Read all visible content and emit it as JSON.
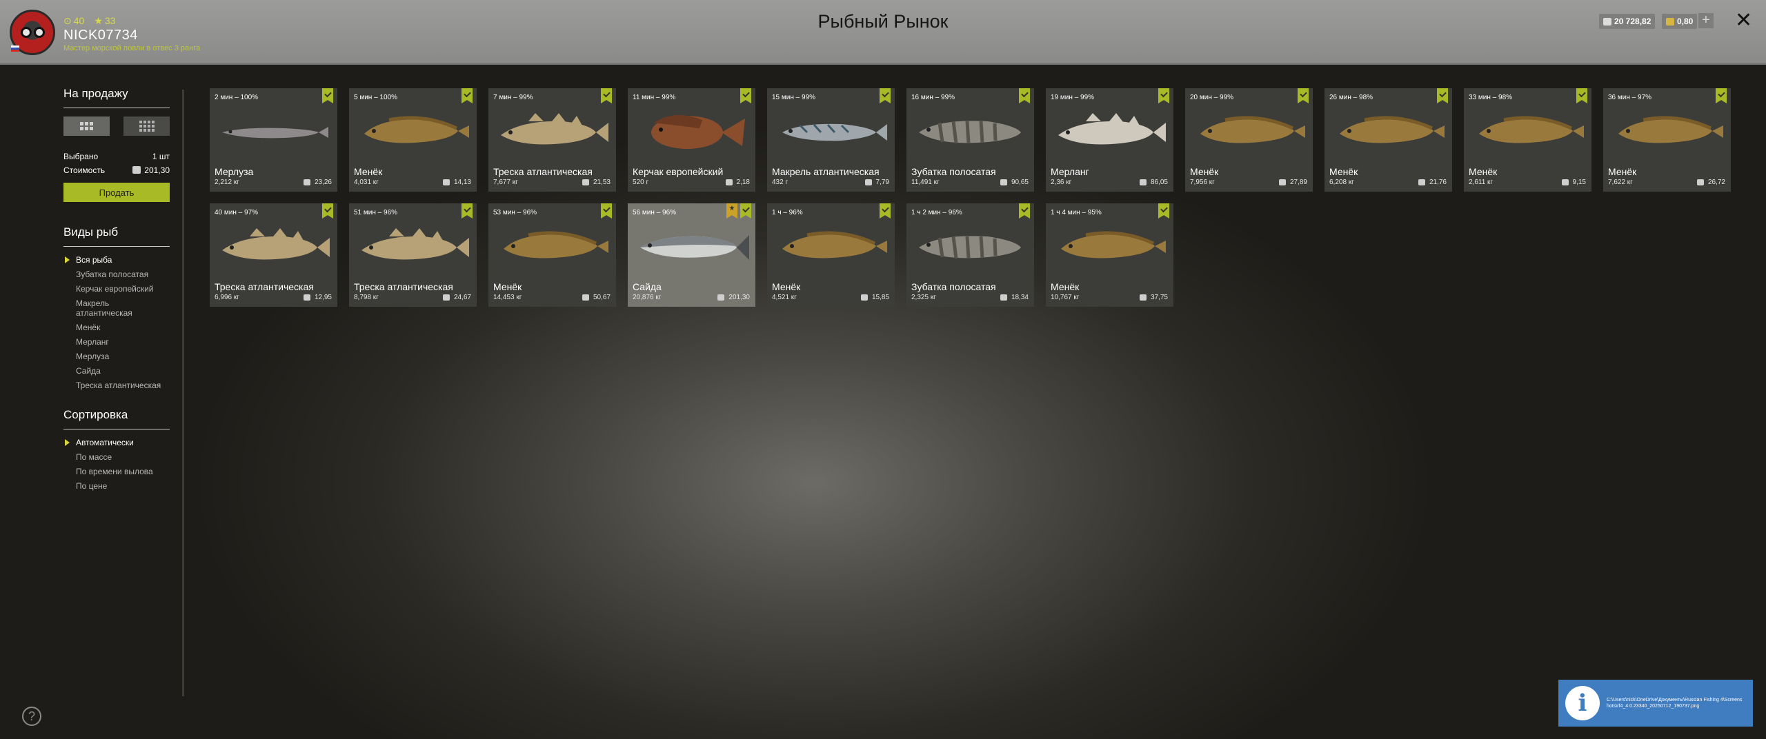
{
  "header": {
    "level": "40",
    "stars": "33",
    "nickname": "NICK07734",
    "rank": "Мастер морской ловли в отвес 3 ранга",
    "title": "Рыбный Рынок",
    "silver": "20 728,82",
    "gold": "0,80",
    "plus": "+",
    "close": "✕"
  },
  "sidebar": {
    "sale_title": "На продажу",
    "selected_label": "Выбрано",
    "selected_value": "1 шт",
    "cost_label": "Стоимость",
    "cost_value": "201,30",
    "sell_button": "Продать",
    "species_title": "Виды рыб",
    "species": [
      "Вся рыба",
      "Зубатка полосатая",
      "Керчак европейский",
      "Макрель атлантическая",
      "Менёк",
      "Мерланг",
      "Мерлуза",
      "Сайда",
      "Треска атлантическая"
    ],
    "sort_title": "Сортировка",
    "sort": [
      "Автоматически",
      "По массе",
      "По времени вылова",
      "По цене"
    ]
  },
  "fish": [
    {
      "time": "2 мин – 100%",
      "name": "Мерлуза",
      "weight": "2,212 кг",
      "price": "23,26",
      "kind": "hake",
      "color": "#8e8a8c",
      "selected": false
    },
    {
      "time": "5 мин – 100%",
      "name": "Менёк",
      "weight": "4,031 кг",
      "price": "14,13",
      "kind": "tusk",
      "color": "#9a7a3c",
      "selected": false
    },
    {
      "time": "7 мин – 99%",
      "name": "Треска атлантическая",
      "weight": "7,677 кг",
      "price": "21,53",
      "kind": "cod",
      "color": "#b6a276",
      "selected": false
    },
    {
      "time": "11 мин – 99%",
      "name": "Керчак европейский",
      "weight": "520 г",
      "price": "2,18",
      "kind": "sculpin",
      "color": "#8b4e2c",
      "selected": false
    },
    {
      "time": "15 мин – 99%",
      "name": "Макрель атлантическая",
      "weight": "432 г",
      "price": "7,79",
      "kind": "mackerel",
      "color": "#9fa7ad",
      "selected": false
    },
    {
      "time": "16 мин – 99%",
      "name": "Зубатка полосатая",
      "weight": "11,491 кг",
      "price": "90,65",
      "kind": "wolffish",
      "color": "#8c8a80",
      "selected": false
    },
    {
      "time": "19 мин – 99%",
      "name": "Мерланг",
      "weight": "2,36 кг",
      "price": "86,05",
      "kind": "whiting",
      "color": "#cfc9bd",
      "selected": false
    },
    {
      "time": "20 мин – 99%",
      "name": "Менёк",
      "weight": "7,956 кг",
      "price": "27,89",
      "kind": "tusk",
      "color": "#9a7a3c",
      "selected": false
    },
    {
      "time": "26 мин – 98%",
      "name": "Менёк",
      "weight": "6,208 кг",
      "price": "21,76",
      "kind": "tusk",
      "color": "#9a7a3c",
      "selected": false
    },
    {
      "time": "33 мин – 98%",
      "name": "Менёк",
      "weight": "2,611 кг",
      "price": "9,15",
      "kind": "tusk",
      "color": "#9a7a3c",
      "selected": false
    },
    {
      "time": "36 мин – 97%",
      "name": "Менёк",
      "weight": "7,622 кг",
      "price": "26,72",
      "kind": "tusk",
      "color": "#9a7a3c",
      "selected": false
    },
    {
      "time": "40 мин – 97%",
      "name": "Треска атлантическая",
      "weight": "6,996 кг",
      "price": "12,95",
      "kind": "cod",
      "color": "#b6a276",
      "selected": false
    },
    {
      "time": "51 мин – 96%",
      "name": "Треска атлантическая",
      "weight": "8,798 кг",
      "price": "24,67",
      "kind": "cod",
      "color": "#b6a276",
      "selected": false
    },
    {
      "time": "53 мин – 96%",
      "name": "Менёк",
      "weight": "14,453 кг",
      "price": "50,67",
      "kind": "tusk",
      "color": "#9a7a3c",
      "selected": false
    },
    {
      "time": "56 мин – 96%",
      "name": "Сайда",
      "weight": "20,876 кг",
      "price": "201,30",
      "kind": "pollock",
      "color": "#7c8286",
      "selected": true
    },
    {
      "time": "1 ч – 96%",
      "name": "Менёк",
      "weight": "4,521 кг",
      "price": "15,85",
      "kind": "tusk",
      "color": "#9a7a3c",
      "selected": false
    },
    {
      "time": "1 ч 2 мин – 96%",
      "name": "Зубатка полосатая",
      "weight": "2,325 кг",
      "price": "18,34",
      "kind": "wolffish",
      "color": "#8c8a80",
      "selected": false
    },
    {
      "time": "1 ч 4 мин – 95%",
      "name": "Менёк",
      "weight": "10,767 кг",
      "price": "37,75",
      "kind": "tusk",
      "color": "#9a7a3c",
      "selected": false
    }
  ],
  "toast": {
    "icon": "i",
    "path": "C:\\Users\\nick\\OneDrive\\Документы\\Russian Fishing 4\\Screenshots\\rf4_4.0.23340_20250712_190737.png"
  },
  "help": "?",
  "colors": {
    "accent": "#a8bb27",
    "rank": "#bdc63d",
    "toast": "#3f7cc0"
  }
}
